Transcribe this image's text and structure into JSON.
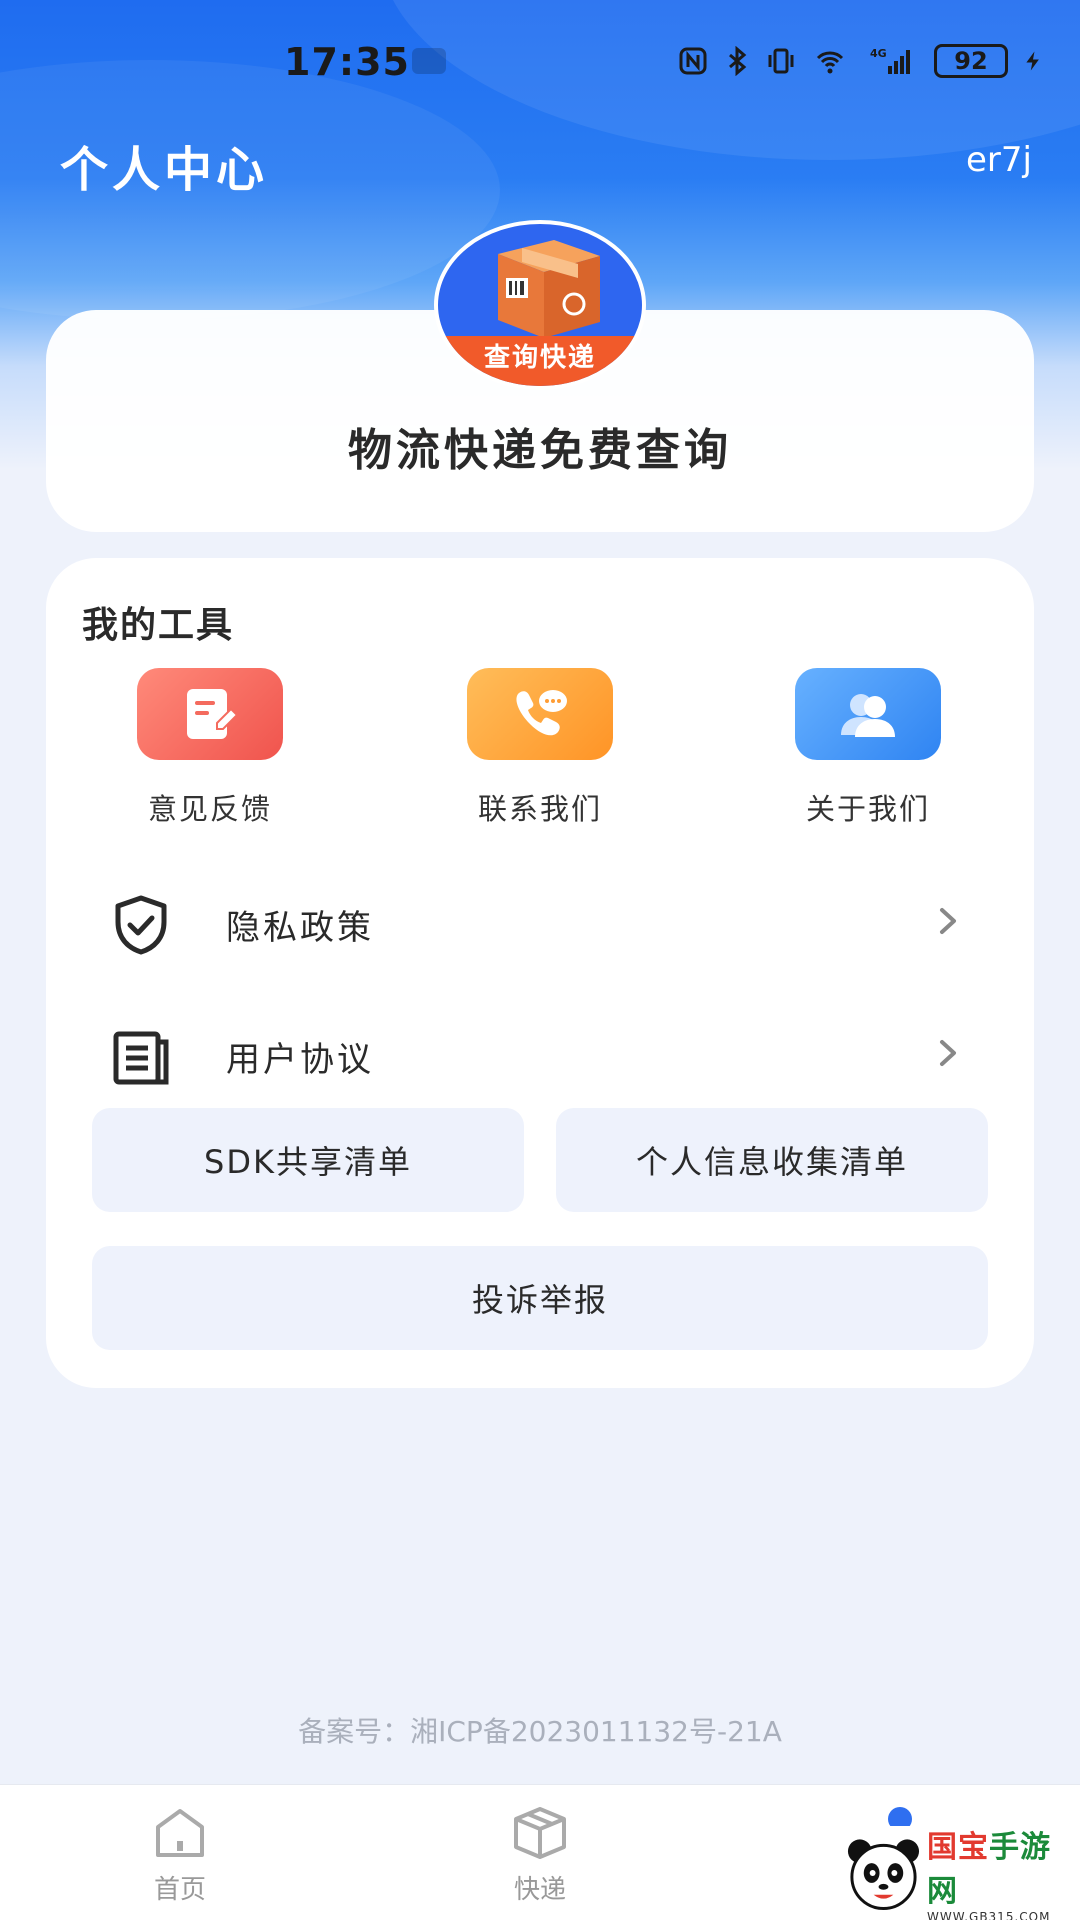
{
  "status_bar": {
    "time": "17:35",
    "battery": "92",
    "network": "4G",
    "icons": [
      "nfc-icon",
      "bluetooth-icon",
      "vibrate-icon",
      "wifi-icon",
      "signal-icon",
      "charging-icon"
    ]
  },
  "header": {
    "title": "个人中心",
    "user_name": "er7j"
  },
  "profile": {
    "avatar_ribbon": "查询快递",
    "app_name": "物流快递免费查询"
  },
  "tools": {
    "title": "我的工具",
    "items": [
      {
        "label": "意见反馈",
        "icon": "feedback-icon",
        "color": "#f0544d"
      },
      {
        "label": "联系我们",
        "icon": "phone-chat-icon",
        "color": "#ff9426"
      },
      {
        "label": "关于我们",
        "icon": "users-icon",
        "color": "#2f84f2"
      }
    ],
    "rows": [
      {
        "label": "隐私政策",
        "icon": "shield-check-icon"
      },
      {
        "label": "用户协议",
        "icon": "document-icon"
      }
    ],
    "buttons": {
      "sdk": "SDK共享清单",
      "personal_info": "个人信息收集清单",
      "complaint": "投诉举报"
    }
  },
  "footer": {
    "icp": "备案号：湘ICP备2023011132号-21A"
  },
  "bottom_nav": {
    "items": [
      {
        "label": "首页",
        "icon": "home-icon"
      },
      {
        "label": "快递",
        "icon": "package-icon"
      },
      {
        "label": "",
        "icon": "profile-icon",
        "active": true
      }
    ]
  },
  "watermark": {
    "main_red": "国宝",
    "main_green": "手游网",
    "sub": "WWW.GB315.COM"
  }
}
